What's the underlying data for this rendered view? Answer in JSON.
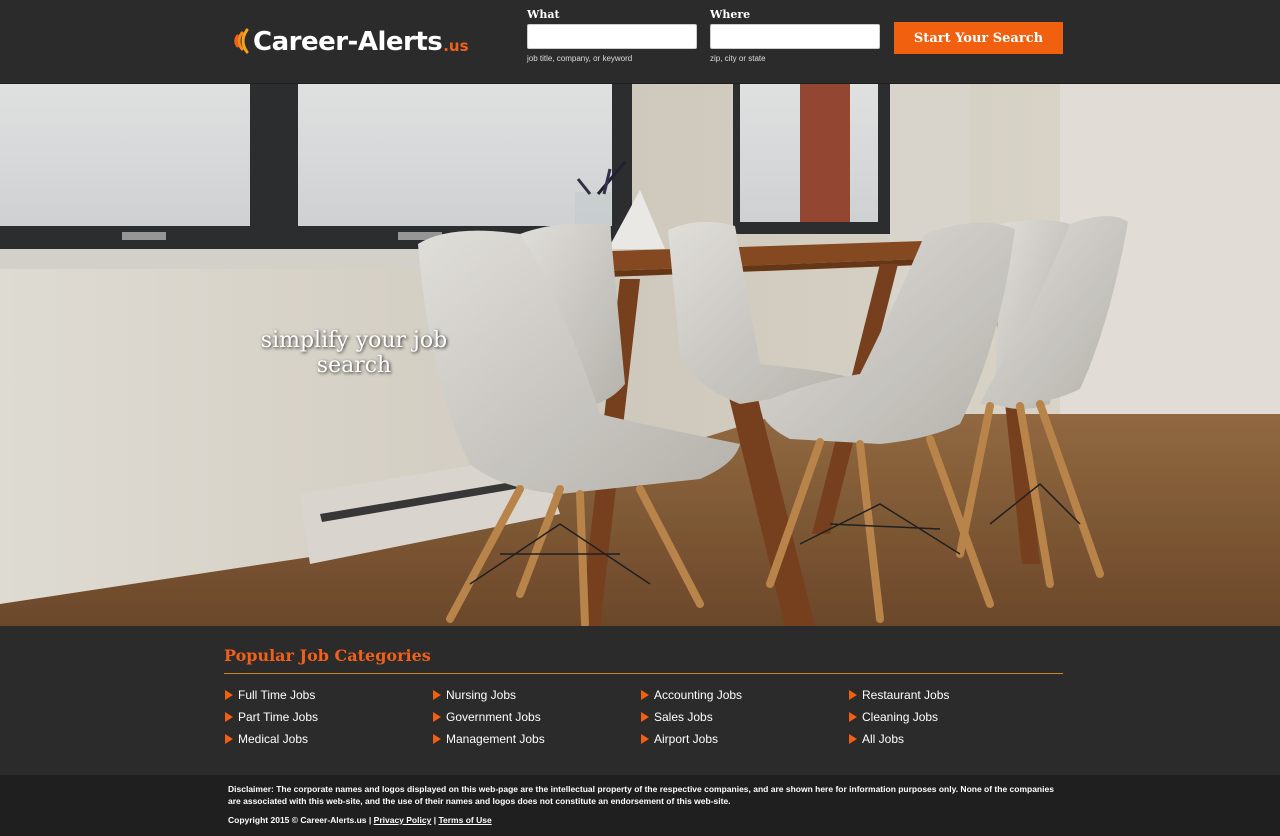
{
  "header": {
    "logo": {
      "main": "Career-Alerts",
      "tld": ".us"
    },
    "what": {
      "label": "What",
      "value": "",
      "placeholder": "",
      "hint": "job title, company, or keyword"
    },
    "where": {
      "label": "Where",
      "value": "",
      "placeholder": "",
      "hint": "zip, city or state"
    },
    "search_button": "Start Your Search"
  },
  "hero": {
    "tagline": "simplify your job search"
  },
  "categories": {
    "title": "Popular Job Categories",
    "items": [
      "Full Time Jobs",
      "Nursing Jobs",
      "Accounting Jobs",
      "Restaurant Jobs",
      "Part Time Jobs",
      "Government Jobs",
      "Sales Jobs",
      "Cleaning Jobs",
      "Medical Jobs",
      "Management Jobs",
      "Airport Jobs",
      "All Jobs"
    ]
  },
  "footer": {
    "disclaimer": "Disclaimer: The corporate names and logos displayed on this web-page are the intellectual property of the respective companies, and are shown here for information purposes only. None of the companies are associated with this web-site, and the use of their names and logos does not constitute an endorsement of this web-site.",
    "copyright": "Copyright 2015 © Career-Alerts.us |",
    "privacy_link": "Privacy Policy",
    "separator": "|",
    "terms_link": "Terms of Use"
  },
  "colors": {
    "accent": "#f0600f",
    "header_bg": "#2b2b2b",
    "footer_bg": "#1f1f1f"
  },
  "icons": {
    "logo": "signal-waves-icon",
    "category_bullet": "triangle-right-icon"
  }
}
